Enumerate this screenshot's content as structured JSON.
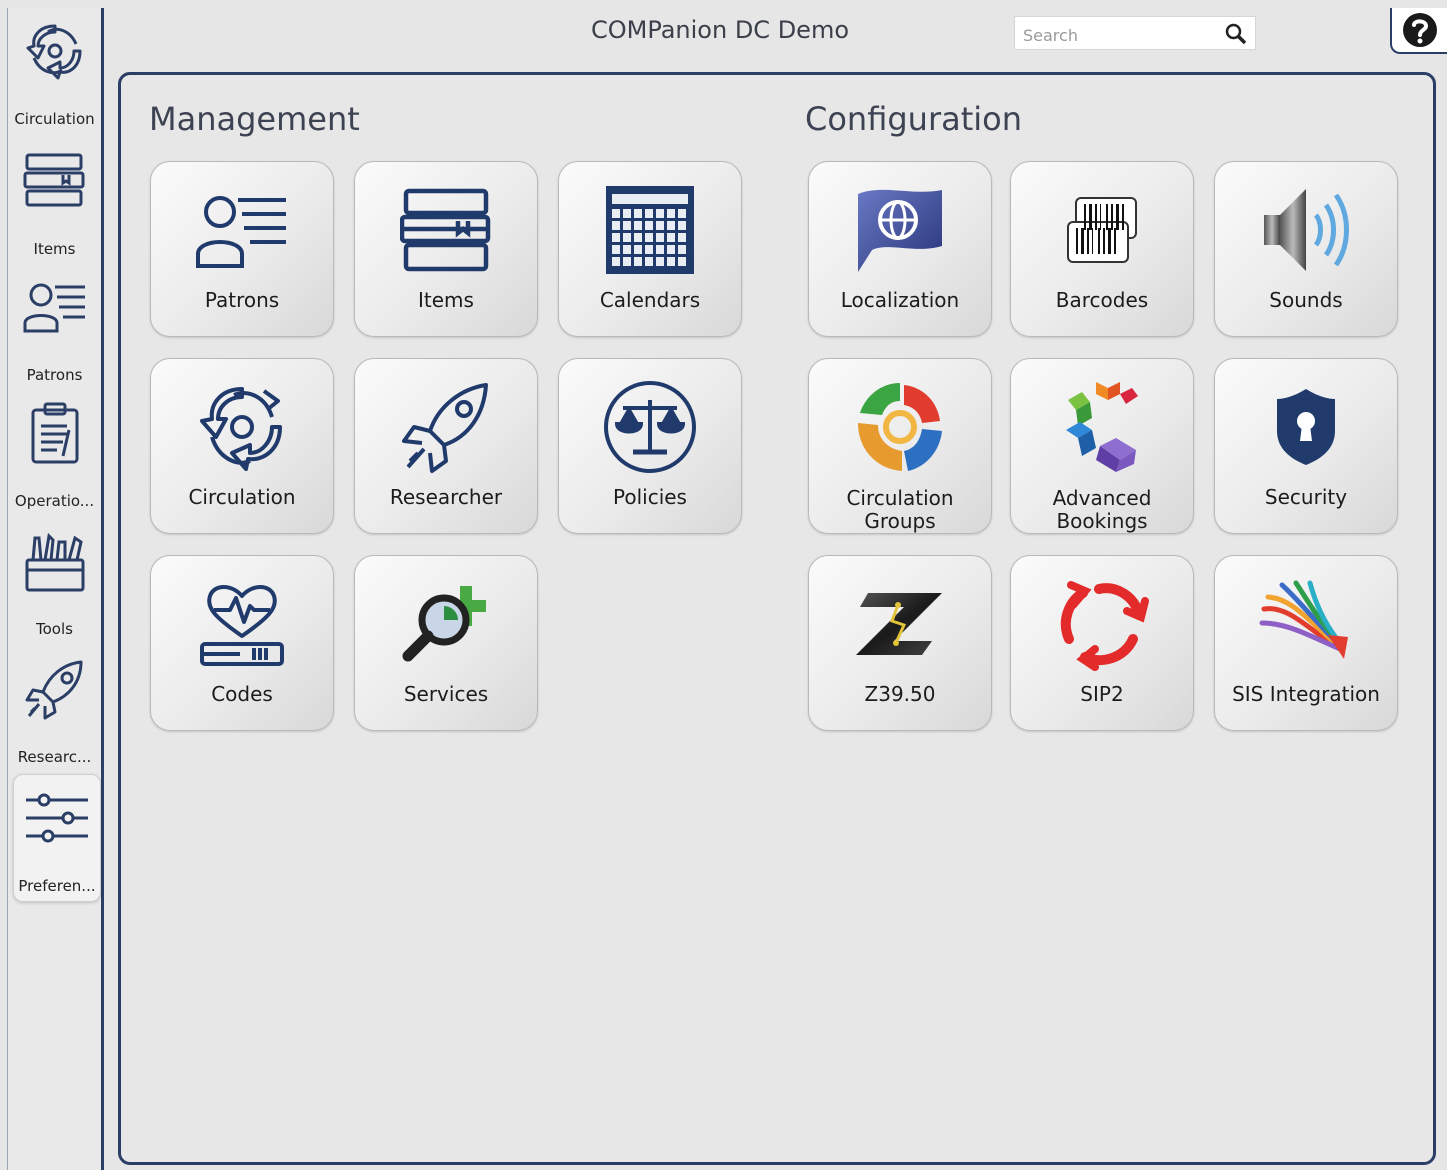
{
  "app": {
    "title": "COMPanion DC Demo"
  },
  "search": {
    "placeholder": "Search"
  },
  "sidebar": {
    "items": [
      {
        "label": "Circulation"
      },
      {
        "label": "Items"
      },
      {
        "label": "Patrons"
      },
      {
        "label": "Operatio..."
      },
      {
        "label": "Tools"
      },
      {
        "label": "Researc..."
      },
      {
        "label": "Preferen...",
        "selected": true
      }
    ]
  },
  "management": {
    "title": "Management",
    "tiles": [
      {
        "label": "Patrons",
        "icon": "patron-list-icon"
      },
      {
        "label": "Items",
        "icon": "books-icon"
      },
      {
        "label": "Calendars",
        "icon": "calendar-grid-icon"
      },
      {
        "label": "Circulation",
        "icon": "circulation-arrows-icon"
      },
      {
        "label": "Researcher",
        "icon": "rocket-icon"
      },
      {
        "label": "Policies",
        "icon": "scales-icon"
      },
      {
        "label": "Codes",
        "icon": "heart-pulse-icon"
      },
      {
        "label": "Services",
        "icon": "magnifier-plus-icon"
      }
    ]
  },
  "configuration": {
    "title": "Configuration",
    "tiles": [
      {
        "label": "Localization",
        "icon": "globe-flag-icon"
      },
      {
        "label": "Barcodes",
        "icon": "barcode-icon"
      },
      {
        "label": "Sounds",
        "icon": "speaker-icon"
      },
      {
        "label_lines": [
          "Circulation",
          "Groups"
        ],
        "icon": "colored-swirl-icon"
      },
      {
        "label_lines": [
          "Advanced",
          "Bookings"
        ],
        "icon": "colored-cubes-icon"
      },
      {
        "label": "Security",
        "icon": "shield-lock-icon"
      },
      {
        "label": "Z39.50",
        "icon": "z-logo-icon"
      },
      {
        "label": "SIP2",
        "icon": "red-cycle-arrows-icon"
      },
      {
        "label": "SIS Integration",
        "icon": "converging-lines-icon"
      }
    ]
  },
  "colors": {
    "navy": "#2b3e66",
    "icon_blue": "#1f3a6b"
  }
}
